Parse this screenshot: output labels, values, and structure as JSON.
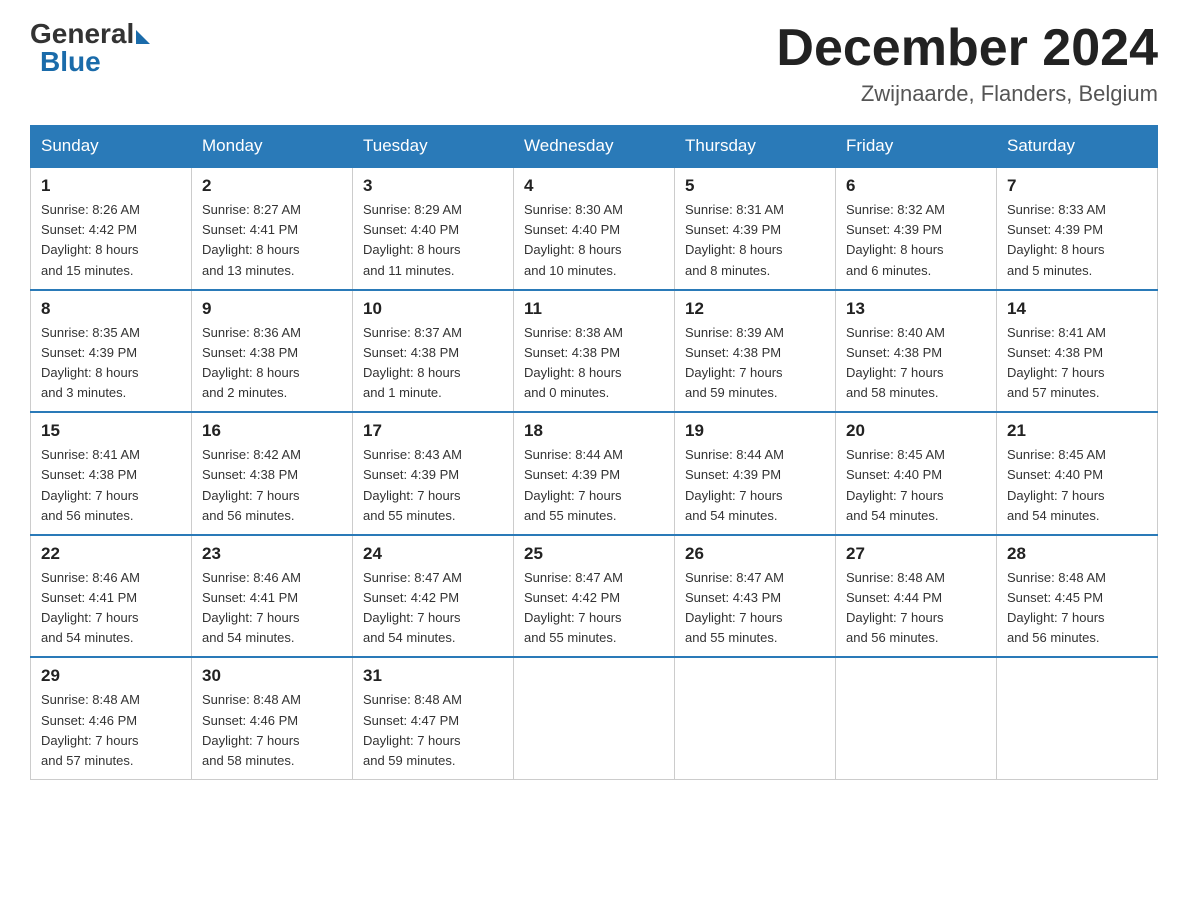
{
  "logo": {
    "general": "General",
    "blue": "Blue",
    "subtitle": ""
  },
  "title": {
    "month_year": "December 2024",
    "location": "Zwijnaarde, Flanders, Belgium"
  },
  "days_of_week": [
    "Sunday",
    "Monday",
    "Tuesday",
    "Wednesday",
    "Thursday",
    "Friday",
    "Saturday"
  ],
  "weeks": [
    [
      {
        "day": "1",
        "info": "Sunrise: 8:26 AM\nSunset: 4:42 PM\nDaylight: 8 hours\nand 15 minutes."
      },
      {
        "day": "2",
        "info": "Sunrise: 8:27 AM\nSunset: 4:41 PM\nDaylight: 8 hours\nand 13 minutes."
      },
      {
        "day": "3",
        "info": "Sunrise: 8:29 AM\nSunset: 4:40 PM\nDaylight: 8 hours\nand 11 minutes."
      },
      {
        "day": "4",
        "info": "Sunrise: 8:30 AM\nSunset: 4:40 PM\nDaylight: 8 hours\nand 10 minutes."
      },
      {
        "day": "5",
        "info": "Sunrise: 8:31 AM\nSunset: 4:39 PM\nDaylight: 8 hours\nand 8 minutes."
      },
      {
        "day": "6",
        "info": "Sunrise: 8:32 AM\nSunset: 4:39 PM\nDaylight: 8 hours\nand 6 minutes."
      },
      {
        "day": "7",
        "info": "Sunrise: 8:33 AM\nSunset: 4:39 PM\nDaylight: 8 hours\nand 5 minutes."
      }
    ],
    [
      {
        "day": "8",
        "info": "Sunrise: 8:35 AM\nSunset: 4:39 PM\nDaylight: 8 hours\nand 3 minutes."
      },
      {
        "day": "9",
        "info": "Sunrise: 8:36 AM\nSunset: 4:38 PM\nDaylight: 8 hours\nand 2 minutes."
      },
      {
        "day": "10",
        "info": "Sunrise: 8:37 AM\nSunset: 4:38 PM\nDaylight: 8 hours\nand 1 minute."
      },
      {
        "day": "11",
        "info": "Sunrise: 8:38 AM\nSunset: 4:38 PM\nDaylight: 8 hours\nand 0 minutes."
      },
      {
        "day": "12",
        "info": "Sunrise: 8:39 AM\nSunset: 4:38 PM\nDaylight: 7 hours\nand 59 minutes."
      },
      {
        "day": "13",
        "info": "Sunrise: 8:40 AM\nSunset: 4:38 PM\nDaylight: 7 hours\nand 58 minutes."
      },
      {
        "day": "14",
        "info": "Sunrise: 8:41 AM\nSunset: 4:38 PM\nDaylight: 7 hours\nand 57 minutes."
      }
    ],
    [
      {
        "day": "15",
        "info": "Sunrise: 8:41 AM\nSunset: 4:38 PM\nDaylight: 7 hours\nand 56 minutes."
      },
      {
        "day": "16",
        "info": "Sunrise: 8:42 AM\nSunset: 4:38 PM\nDaylight: 7 hours\nand 56 minutes."
      },
      {
        "day": "17",
        "info": "Sunrise: 8:43 AM\nSunset: 4:39 PM\nDaylight: 7 hours\nand 55 minutes."
      },
      {
        "day": "18",
        "info": "Sunrise: 8:44 AM\nSunset: 4:39 PM\nDaylight: 7 hours\nand 55 minutes."
      },
      {
        "day": "19",
        "info": "Sunrise: 8:44 AM\nSunset: 4:39 PM\nDaylight: 7 hours\nand 54 minutes."
      },
      {
        "day": "20",
        "info": "Sunrise: 8:45 AM\nSunset: 4:40 PM\nDaylight: 7 hours\nand 54 minutes."
      },
      {
        "day": "21",
        "info": "Sunrise: 8:45 AM\nSunset: 4:40 PM\nDaylight: 7 hours\nand 54 minutes."
      }
    ],
    [
      {
        "day": "22",
        "info": "Sunrise: 8:46 AM\nSunset: 4:41 PM\nDaylight: 7 hours\nand 54 minutes."
      },
      {
        "day": "23",
        "info": "Sunrise: 8:46 AM\nSunset: 4:41 PM\nDaylight: 7 hours\nand 54 minutes."
      },
      {
        "day": "24",
        "info": "Sunrise: 8:47 AM\nSunset: 4:42 PM\nDaylight: 7 hours\nand 54 minutes."
      },
      {
        "day": "25",
        "info": "Sunrise: 8:47 AM\nSunset: 4:42 PM\nDaylight: 7 hours\nand 55 minutes."
      },
      {
        "day": "26",
        "info": "Sunrise: 8:47 AM\nSunset: 4:43 PM\nDaylight: 7 hours\nand 55 minutes."
      },
      {
        "day": "27",
        "info": "Sunrise: 8:48 AM\nSunset: 4:44 PM\nDaylight: 7 hours\nand 56 minutes."
      },
      {
        "day": "28",
        "info": "Sunrise: 8:48 AM\nSunset: 4:45 PM\nDaylight: 7 hours\nand 56 minutes."
      }
    ],
    [
      {
        "day": "29",
        "info": "Sunrise: 8:48 AM\nSunset: 4:46 PM\nDaylight: 7 hours\nand 57 minutes."
      },
      {
        "day": "30",
        "info": "Sunrise: 8:48 AM\nSunset: 4:46 PM\nDaylight: 7 hours\nand 58 minutes."
      },
      {
        "day": "31",
        "info": "Sunrise: 8:48 AM\nSunset: 4:47 PM\nDaylight: 7 hours\nand 59 minutes."
      },
      {
        "day": "",
        "info": ""
      },
      {
        "day": "",
        "info": ""
      },
      {
        "day": "",
        "info": ""
      },
      {
        "day": "",
        "info": ""
      }
    ]
  ]
}
